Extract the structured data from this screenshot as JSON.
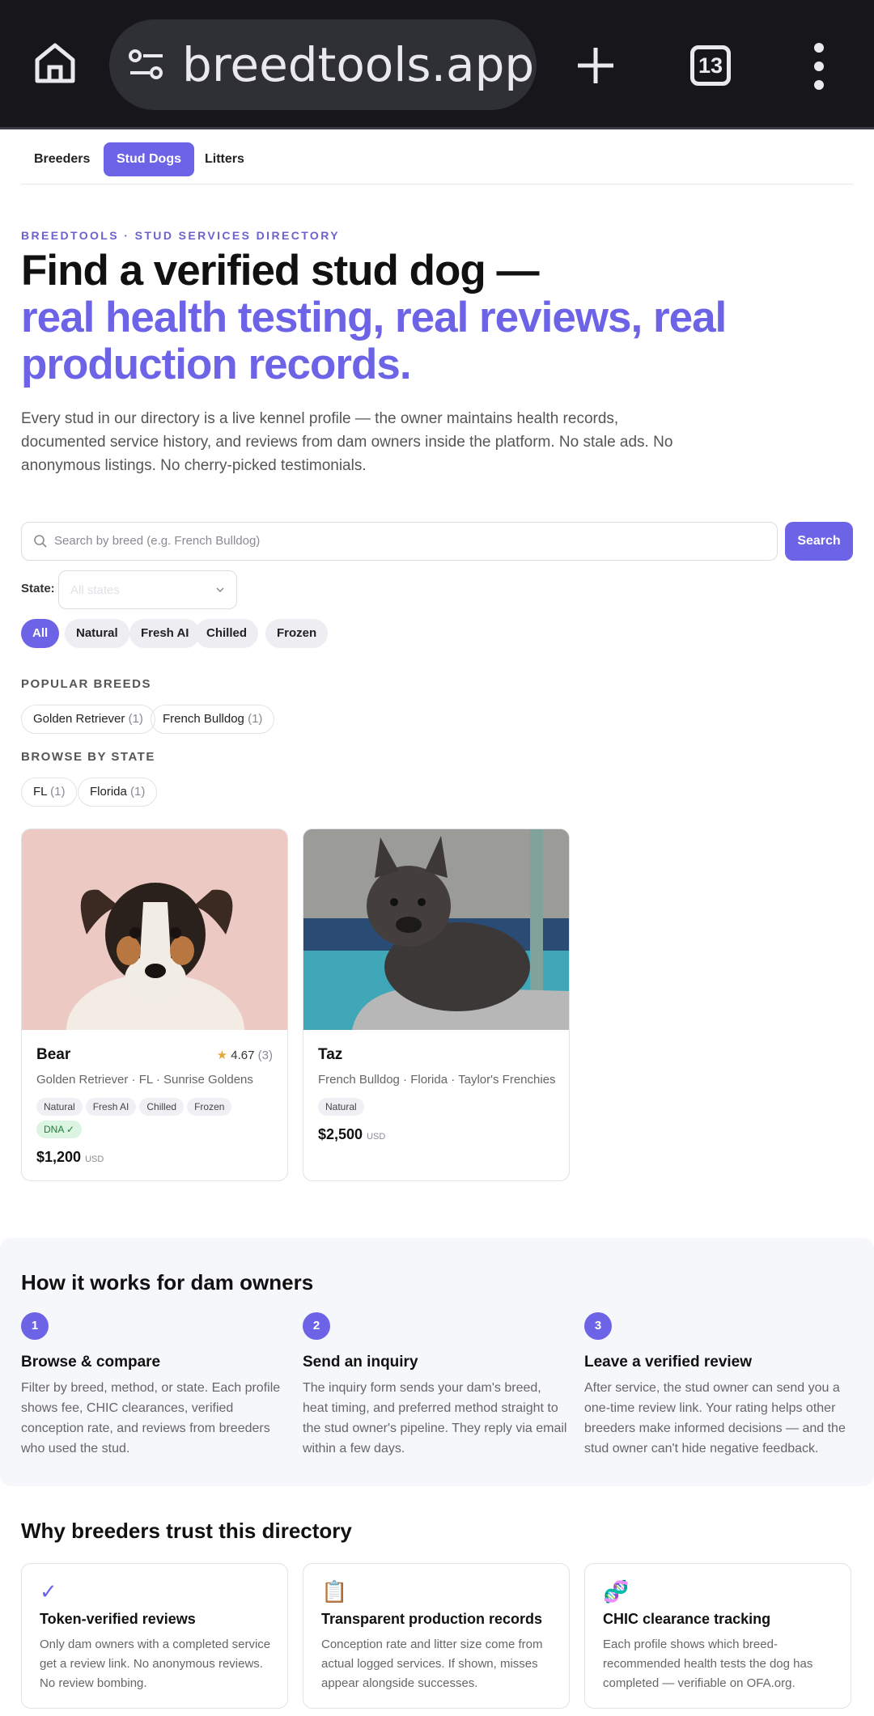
{
  "browser": {
    "url": "breedtools.app/s",
    "tab_count": "13",
    "colors": {
      "chrome_bg": "#16161b",
      "urlbar_bg": "#2f3035"
    }
  },
  "nav": {
    "tabs": [
      "Breeders",
      "Stud Dogs",
      "Litters"
    ],
    "active": "Stud Dogs"
  },
  "hero": {
    "eyebrow": "BREEDTOOLS · STUD SERVICES DIRECTORY",
    "title_dark": "Find a verified stud dog —",
    "title_accent": "real health testing, real reviews, real production records.",
    "lede": "Every stud in our directory is a live kennel profile — the owner maintains health records, documented service history, and reviews from dam owners inside the platform. No stale ads. No anonymous listings. No cherry-picked testimonials."
  },
  "search": {
    "placeholder": "Search by breed (e.g. French Bulldog)",
    "button": "Search"
  },
  "state_filter": {
    "label": "State:",
    "placeholder": "All states"
  },
  "method_chips": [
    "All",
    "Natural",
    "Fresh AI",
    "Chilled",
    "Frozen"
  ],
  "popular_breeds": {
    "label": "POPULAR BREEDS",
    "items": [
      {
        "name": "Golden Retriever",
        "count": "(1)"
      },
      {
        "name": "French Bulldog",
        "count": "(1)"
      }
    ]
  },
  "browse_state": {
    "label": "BROWSE BY STATE",
    "items": [
      {
        "name": "FL",
        "count": "(1)"
      },
      {
        "name": "Florida",
        "count": "(1)"
      }
    ]
  },
  "studs": [
    {
      "name": "Bear",
      "rating": "4.67",
      "rating_count": "(3)",
      "meta": "Golden Retriever · FL · Sunrise Goldens",
      "tags": [
        "Natural",
        "Fresh AI",
        "Chilled",
        "Frozen"
      ],
      "dna": "DNA ✓",
      "price": "$1,200",
      "currency": "USD"
    },
    {
      "name": "Taz",
      "meta": "French Bulldog · Florida · Taylor's Frenchies",
      "tags": [
        "Natural"
      ],
      "price": "$2,500",
      "currency": "USD"
    }
  ],
  "how": {
    "title": "How it works for dam owners",
    "steps": [
      {
        "num": "1",
        "title": "Browse & compare",
        "body": "Filter by breed, method, or state. Each profile shows fee, CHIC clearances, verified conception rate, and reviews from breeders who used the stud."
      },
      {
        "num": "2",
        "title": "Send an inquiry",
        "body": "The inquiry form sends your dam's breed, heat timing, and preferred method straight to the stud owner's pipeline. They reply via email within a few days."
      },
      {
        "num": "3",
        "title": "Leave a verified review",
        "body": "After service, the stud owner can send you a one-time review link. Your rating helps other breeders make informed decisions — and the stud owner can't hide negative feedback."
      }
    ]
  },
  "trust": {
    "title": "Why breeders trust this directory",
    "cards": [
      {
        "icon": "✓",
        "title": "Token-verified reviews",
        "body": "Only dam owners with a completed service get a review link. No anonymous reviews. No review bombing."
      },
      {
        "icon": "📋",
        "title": "Transparent production records",
        "body": "Conception rate and litter size come from actual logged services. If shown, misses appear alongside successes."
      },
      {
        "icon": "🧬",
        "title": "CHIC clearance tracking",
        "body": "Each profile shows which breed-recommended health tests the dog has completed — verifiable on OFA.org."
      }
    ]
  },
  "colors": {
    "accent": "#6c63e6",
    "star": "#e0a93b",
    "dna_bg": "#dcf5e2"
  }
}
